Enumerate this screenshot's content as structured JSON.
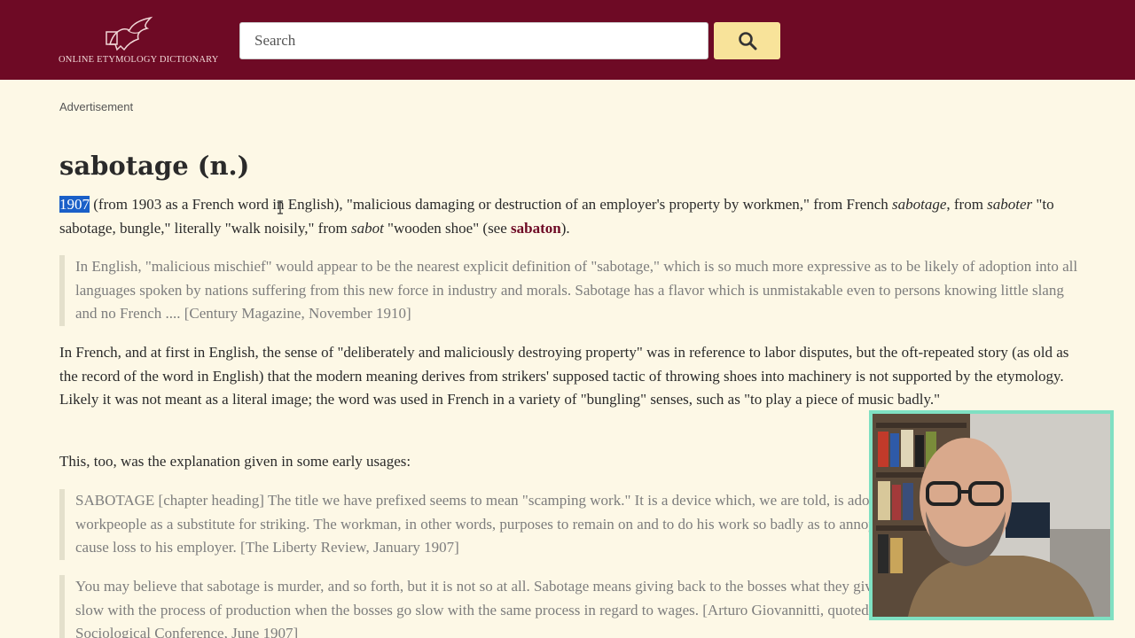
{
  "header": {
    "logo_text": "ONLINE ETYMOLOGY DICTIONARY",
    "search_placeholder": "Search",
    "search_icon": "search-icon"
  },
  "ad_label": "Advertisement",
  "entry": {
    "title": "sabotage (n.)",
    "p1": {
      "year": "1907",
      "t1": " (from 1903 as a French word in English), \"malicious damaging or destruction of an employer's property by workmen,\" from French ",
      "i1": "sabotage",
      "t2": ", from ",
      "i2": "saboter",
      "t3": " \"to sabotage, bungle,\" literally \"walk noisily,\" from ",
      "i3": "sabot",
      "t4": " \"wooden shoe\" (see ",
      "link": "sabaton",
      "t5": ")."
    },
    "quote1": "In English, \"malicious mischief\" would appear to be the nearest explicit definition of \"sabotage,\" which is so much more expressive as to be likely of adoption into all languages spoken by nations suffering from this new force in industry and morals. Sabotage has a flavor which is unmistakable even to persons knowing little slang and no French .... [Century Magazine, November 1910]",
    "p2": "In French, and at first in English, the sense of \"deliberately and maliciously destroying property\" was in reference to labor disputes, but the oft-repeated story (as old as the record of the word in English) that the modern meaning derives from strikers' supposed tactic of throwing shoes into machinery is not supported by the etymology. Likely it was not meant as a literal image; the word was used in French in a variety of \"bungling\" senses, such as \"to play a piece of music badly.\"",
    "p3": "This, too, was the explanation given in some early usages:",
    "quote2": "SABOTAGE [chapter heading] The title we have prefixed seems to mean \"scamping work.\" It is a device which, we are told, is adopted by certain French workpeople as a substitute for striking. The workman, in other words, purposes to remain on and to do his work so badly as to annoy his employer's customers and cause loss to his employer. [The Liberty Review, January 1907]",
    "quote3": "You may believe that sabotage is murder, and so forth, but it is not so at all. Sabotage means giving back to the bosses what they give us. Sabotage consists in going slow with the process of production when the bosses go slow with the same process in regard to wages. [Arturo Giovannitti, quoted in report of the Sagamore Sociological Conference, June 1907]"
  },
  "colors": {
    "header_bg": "#6e0a25",
    "search_button_bg": "#f8e39a",
    "page_bg": "#fdf8e6",
    "link": "#6e0a25",
    "highlight": "#1a5fc8",
    "webcam_border": "#7fe0c2"
  }
}
